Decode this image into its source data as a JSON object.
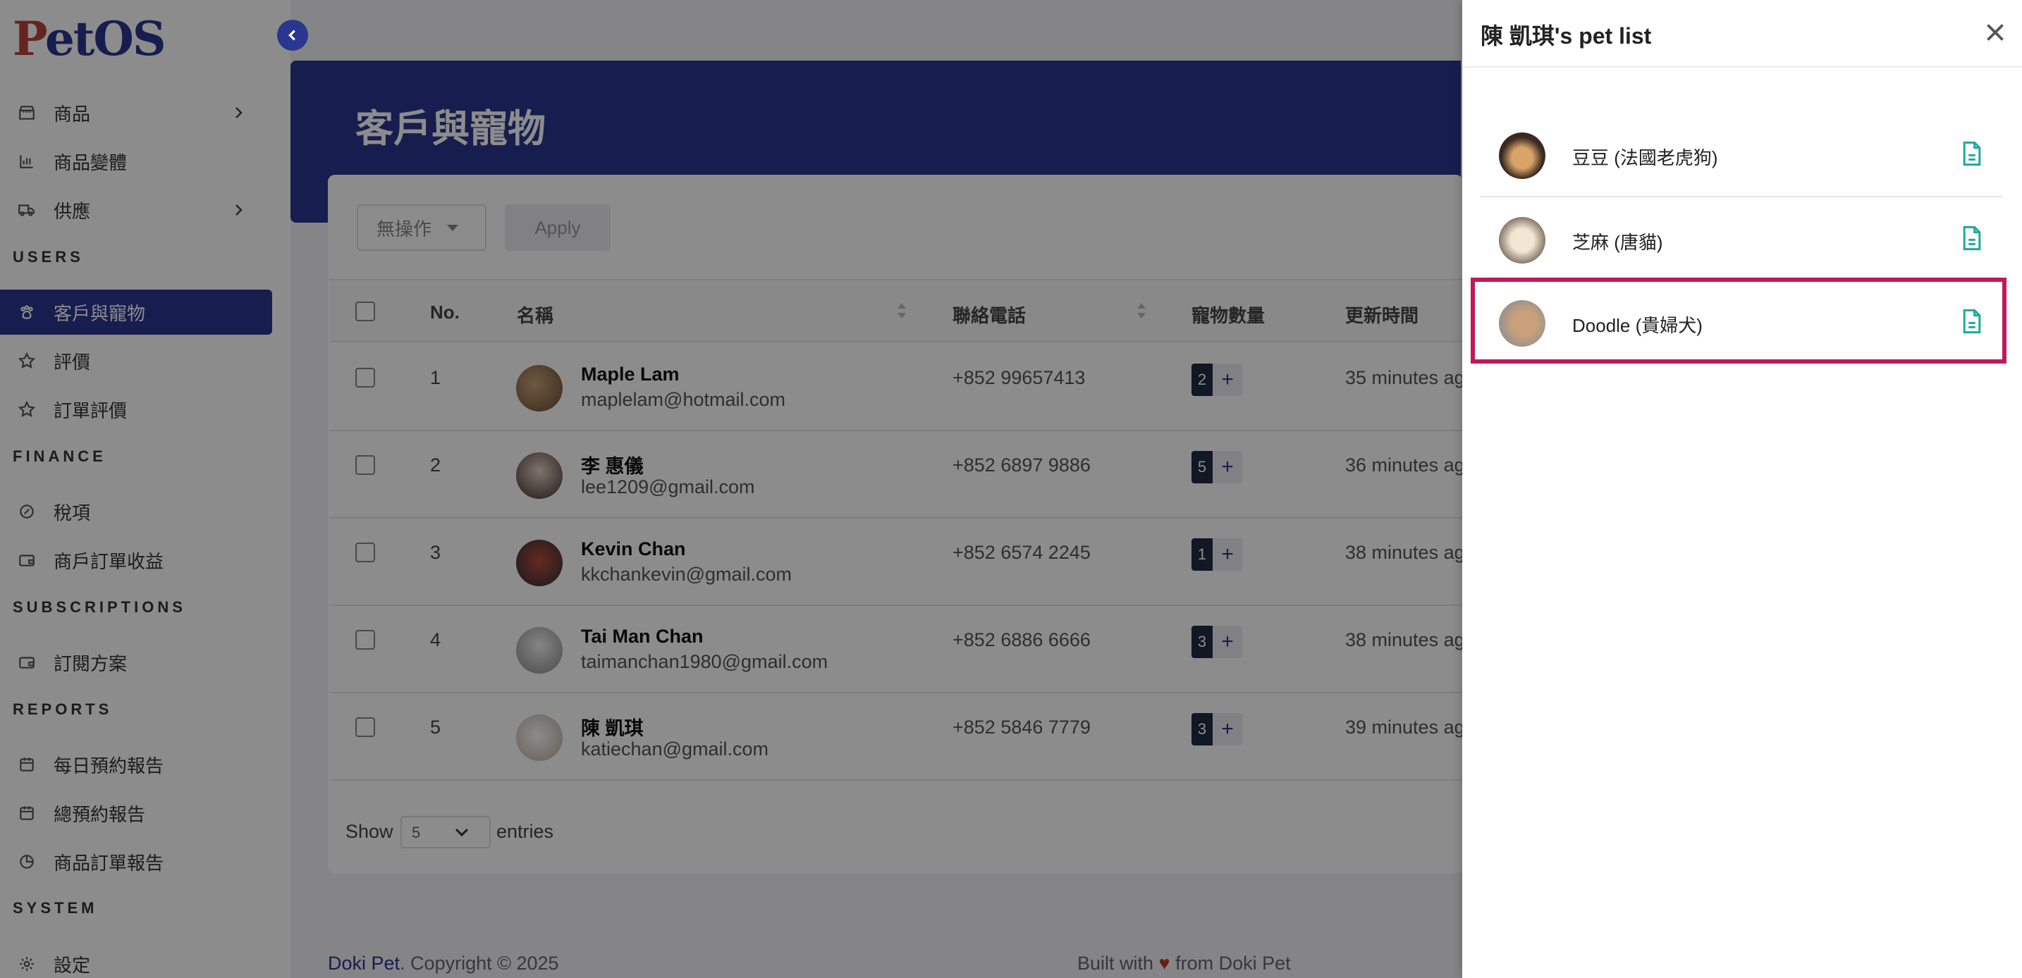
{
  "app": {
    "logo_p": "P",
    "logo_rest": "etOS"
  },
  "sidebar": {
    "items": [
      {
        "label": "商品",
        "icon": "store-icon",
        "has_chevron": true
      },
      {
        "label": "商品變體",
        "icon": "variants-icon",
        "has_chevron": false
      },
      {
        "label": "供應",
        "icon": "truck-icon",
        "has_chevron": true
      },
      {
        "label": "客戶與寵物",
        "icon": "paw-icon",
        "active": true
      },
      {
        "label": "評價",
        "icon": "star-icon"
      },
      {
        "label": "訂單評價",
        "icon": "star-icon"
      },
      {
        "label": "稅項",
        "icon": "tax-icon"
      },
      {
        "label": "商戶訂單收益",
        "icon": "wallet-icon"
      },
      {
        "label": "訂閱方案",
        "icon": "wallet-icon"
      },
      {
        "label": "每日預約報告",
        "icon": "calendar-icon"
      },
      {
        "label": "總預約報告",
        "icon": "calendar-icon"
      },
      {
        "label": "商品訂單報告",
        "icon": "pie-chart-icon"
      },
      {
        "label": "設定",
        "icon": "gear-icon"
      }
    ],
    "sections": {
      "users": "USERS",
      "finance": "FINANCE",
      "subscriptions": "SUBSCRIPTIONS",
      "reports": "REPORTS",
      "system": "SYSTEM"
    }
  },
  "page": {
    "title": "客戶與寵物"
  },
  "toolbar": {
    "bulk_action": "無操作",
    "apply": "Apply"
  },
  "table": {
    "headers": {
      "no": "No.",
      "name": "名稱",
      "phone": "聯絡電話",
      "pets": "寵物數量",
      "updated": "更新時間"
    },
    "rows": [
      {
        "no": "1",
        "name": "Maple Lam",
        "email": "maplelam@hotmail.com",
        "phone": "+852 99657413",
        "pets": "2",
        "updated": "35 minutes ag"
      },
      {
        "no": "2",
        "name": "李 惠儀",
        "email": "lee1209@gmail.com",
        "phone": "+852 6897 9886",
        "pets": "5",
        "updated": "36 minutes ag"
      },
      {
        "no": "3",
        "name": "Kevin Chan",
        "email": "kkchankevin@gmail.com",
        "phone": "+852 6574 2245",
        "pets": "1",
        "updated": "38 minutes ag"
      },
      {
        "no": "4",
        "name": "Tai Man Chan",
        "email": "taimanchan1980@gmail.com",
        "phone": "+852 6886 6666",
        "pets": "3",
        "updated": "38 minutes ag"
      },
      {
        "no": "5",
        "name": "陳 凱琪",
        "email": "katiechan@gmail.com",
        "phone": "+852 5846 7779",
        "pets": "3",
        "updated": "39 minutes ag"
      }
    ],
    "plus": "+"
  },
  "pagination": {
    "show": "Show",
    "page_size": "5",
    "entries": "entries"
  },
  "footer": {
    "brand": "Doki Pet",
    "copyright": ". Copyright © 2025",
    "built_prefix": "Built with ",
    "heart": "♥",
    "built_suffix": " from Doki Pet"
  },
  "drawer": {
    "title": "陳 凱琪's pet list",
    "pets": [
      {
        "name": "豆豆 (法國老虎狗)"
      },
      {
        "name": "芝麻 (唐貓)"
      },
      {
        "name": "Doodle (貴婦犬)"
      }
    ]
  },
  "colors": {
    "brand": "#2b3690",
    "highlight": "#c2185b",
    "doc_icon": "#1fa99a"
  }
}
